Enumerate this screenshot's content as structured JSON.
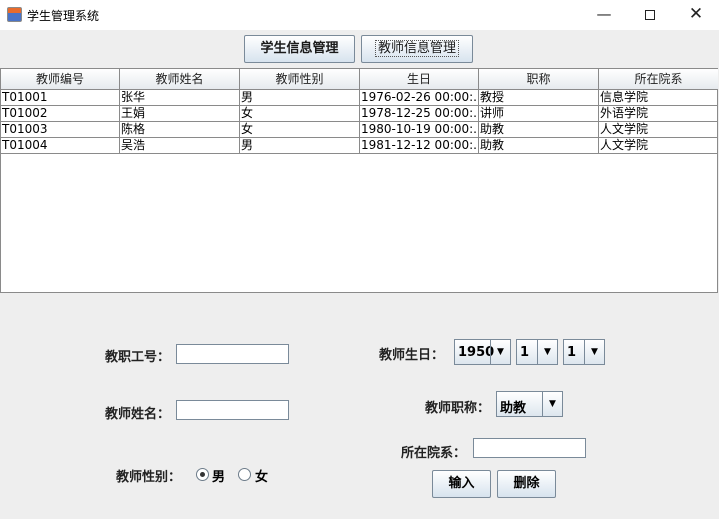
{
  "window": {
    "title": "学生管理系统",
    "min_glyph": "—",
    "close_glyph": "✕"
  },
  "top_buttons": {
    "student": "学生信息管理",
    "teacher": "教师信息管理"
  },
  "table": {
    "columns": [
      "教师编号",
      "教师姓名",
      "教师性别",
      "生日",
      "职称",
      "所在院系"
    ],
    "rows": [
      [
        "T01001",
        "张华",
        "男",
        "1976-02-26 00:00:...",
        "教授",
        "信息学院"
      ],
      [
        "T01002",
        "王娟",
        "女",
        "1978-12-25 00:00:...",
        "讲师",
        "外语学院"
      ],
      [
        "T01003",
        "陈格",
        "女",
        "1980-10-19 00:00:...",
        "助教",
        "人文学院"
      ],
      [
        "T01004",
        "吴浩",
        "男",
        "1981-12-12 00:00:...",
        "助教",
        "人文学院"
      ]
    ]
  },
  "form": {
    "staff_id_label": "教职工号：",
    "staff_id_value": "",
    "name_label": "教师姓名：",
    "name_value": "",
    "gender_label": "教师性别：",
    "gender_options": [
      "男",
      "女"
    ],
    "gender_selected": "男",
    "birthday_label": "教师生日：",
    "birth_year": "1950",
    "birth_month": "1",
    "birth_day": "1",
    "title_label": "教师职称：",
    "title_value": "助教",
    "dept_label": "所在院系：",
    "dept_value": "",
    "input_button": "输入",
    "delete_button": "删除"
  }
}
